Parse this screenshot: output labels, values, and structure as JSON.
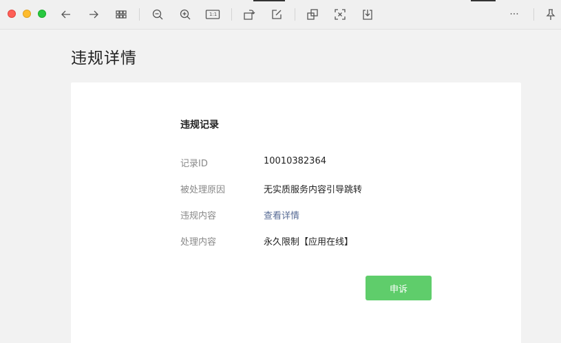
{
  "window": {
    "toolbar_icons": [
      "back-arrow-icon",
      "forward-arrow-icon",
      "grid-view-icon",
      "zoom-out-icon",
      "zoom-in-icon",
      "actual-size-icon",
      "rotate-icon",
      "edit-icon",
      "copy-text-icon",
      "ocr-icon",
      "download-icon",
      "more-icon",
      "pin-icon"
    ],
    "actual_size_label": "1:1",
    "more_label": "···"
  },
  "page": {
    "title": "违规详情"
  },
  "record": {
    "section_title": "违规记录",
    "rows": [
      {
        "label": "记录ID",
        "value": "10010382364"
      },
      {
        "label": "被处理原因",
        "value": "无实质服务内容引导跳转"
      },
      {
        "label": "违规内容",
        "value": "查看详情"
      },
      {
        "label": "处理内容",
        "value": "永久限制【应用在线】"
      }
    ],
    "appeal_label": "申诉"
  },
  "colors": {
    "accent_green": "#5fcd6b",
    "link_blue": "#576b95"
  }
}
